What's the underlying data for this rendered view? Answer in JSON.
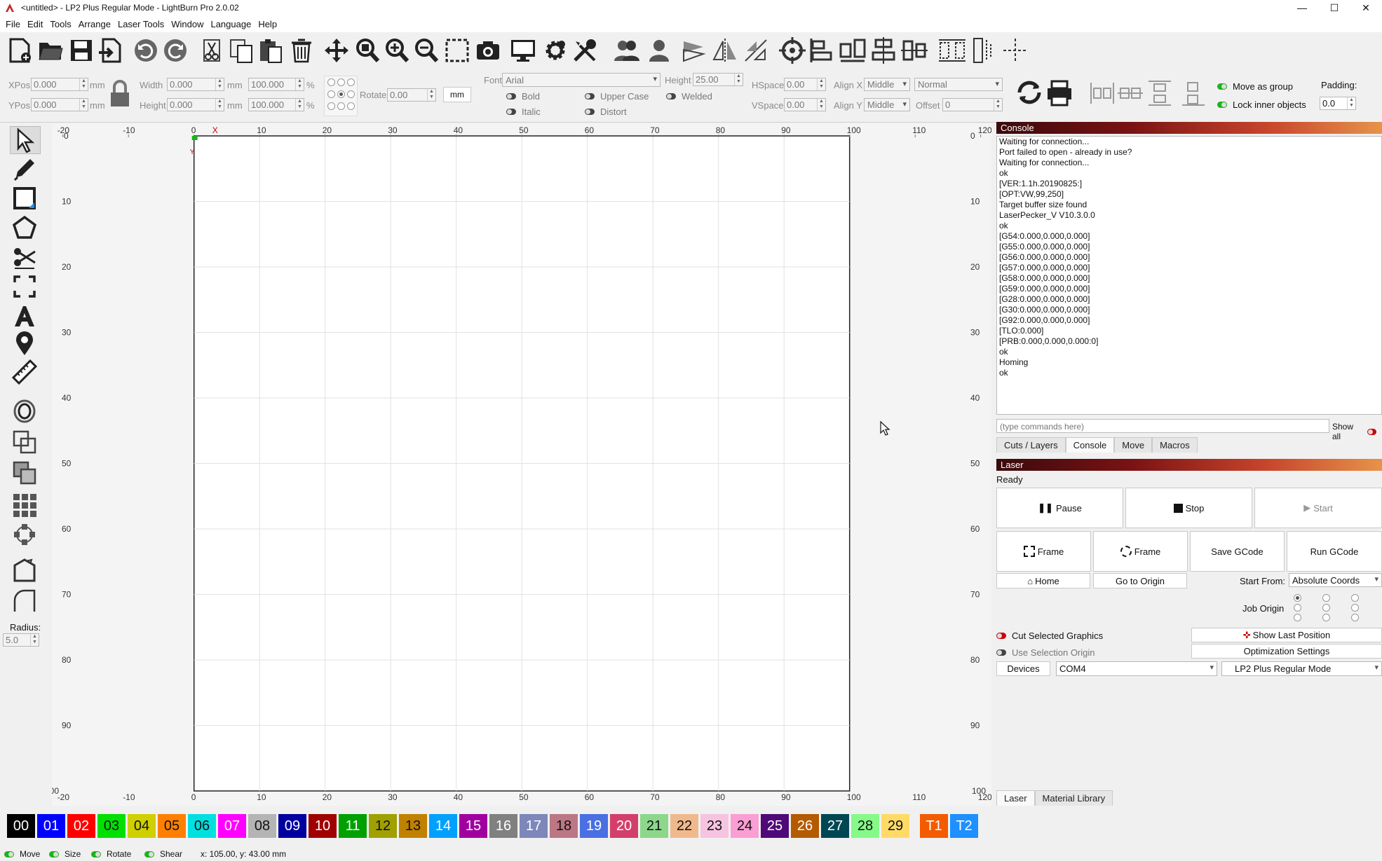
{
  "window": {
    "title": "<untitled> - LP2 Plus Regular Mode - LightBurn Pro 2.0.02"
  },
  "menu": [
    "File",
    "Edit",
    "Tools",
    "Arrange",
    "Laser Tools",
    "Window",
    "Language",
    "Help"
  ],
  "props": {
    "xpos_label": "XPos",
    "xpos": "0.000",
    "ypos_label": "YPos",
    "ypos": "0.000",
    "mm": "mm",
    "width_label": "Width",
    "width": "0.000",
    "height_label": "Height",
    "height": "0.000",
    "wpct": "100.000",
    "hpct": "100.000",
    "pct": "%",
    "rotate_label": "Rotate",
    "rotate": "0.00",
    "unit_btn": "mm",
    "font_label": "Font",
    "font": "Arial",
    "fheight_label": "Height",
    "fheight": "25.00",
    "bold": "Bold",
    "italic": "Italic",
    "upper": "Upper Case",
    "distort": "Distort",
    "welded": "Welded",
    "hspace_label": "HSpace",
    "hspace": "0.00",
    "vspace_label": "VSpace",
    "vspace": "0.00",
    "alignx_label": "Align X",
    "alignx": "Middle",
    "aligny_label": "Align Y",
    "aligny": "Middle",
    "normal": "Normal",
    "offset_label": "Offset",
    "offset": "0",
    "move_group": "Move as group",
    "lock_inner": "Lock inner objects",
    "padding_label": "Padding:",
    "padding": "0.0"
  },
  "left_tools": {
    "radius_label": "Radius:",
    "radius": "5.0"
  },
  "console": {
    "title": "Console",
    "lines": [
      "Waiting for connection...",
      "Port failed to open - already in use?",
      "Waiting for connection...",
      "ok",
      "[VER:1.1h.20190825:]",
      "[OPT:VW,99,250]",
      "Target buffer size found",
      "LaserPecker_V V10.3.0.0",
      "ok",
      "[G54:0.000,0.000,0.000]",
      "[G55:0.000,0.000,0.000]",
      "[G56:0.000,0.000,0.000]",
      "[G57:0.000,0.000,0.000]",
      "[G58:0.000,0.000,0.000]",
      "[G59:0.000,0.000,0.000]",
      "[G28:0.000,0.000,0.000]",
      "[G30:0.000,0.000,0.000]",
      "[G92:0.000,0.000,0.000]",
      "[TLO:0.000]",
      "[PRB:0.000,0.000,0.000:0]",
      "ok",
      "Homing",
      "ok"
    ],
    "placeholder": "(type commands here)",
    "show_all": "Show all"
  },
  "top_tabs": [
    "Cuts / Layers",
    "Console",
    "Move",
    "Macros"
  ],
  "laser": {
    "title": "Laser",
    "status": "Ready",
    "pause": "Pause",
    "stop": "Stop",
    "start": "Start",
    "frame1": "Frame",
    "frame2": "Frame",
    "save_gcode": "Save GCode",
    "run_gcode": "Run GCode",
    "home": "Home",
    "go_origin": "Go to Origin",
    "start_from_label": "Start From:",
    "start_from": "Absolute Coords",
    "job_origin_label": "Job Origin",
    "cut_selected": "Cut Selected Graphics",
    "use_selection": "Use Selection Origin",
    "show_last": "Show Last Position",
    "opt_settings": "Optimization Settings",
    "devices": "Devices",
    "port": "COM4",
    "device": "LP2 Plus Regular Mode"
  },
  "bottom_tabs": [
    "Laser",
    "Material Library"
  ],
  "palette": [
    {
      "l": "00",
      "c": "#000000",
      "w": true
    },
    {
      "l": "01",
      "c": "#0000ff",
      "w": true
    },
    {
      "l": "02",
      "c": "#ff0000",
      "w": true
    },
    {
      "l": "03",
      "c": "#00e000",
      "w": false
    },
    {
      "l": "04",
      "c": "#d0d000",
      "w": false
    },
    {
      "l": "05",
      "c": "#ff8000",
      "w": false
    },
    {
      "l": "06",
      "c": "#00e0e0",
      "w": false
    },
    {
      "l": "07",
      "c": "#ff00ff",
      "w": true
    },
    {
      "l": "08",
      "c": "#b4b4b4",
      "w": false
    },
    {
      "l": "09",
      "c": "#0000a0",
      "w": true
    },
    {
      "l": "10",
      "c": "#a00000",
      "w": true
    },
    {
      "l": "11",
      "c": "#00a000",
      "w": true
    },
    {
      "l": "12",
      "c": "#a0a000",
      "w": false
    },
    {
      "l": "13",
      "c": "#c08000",
      "w": false
    },
    {
      "l": "14",
      "c": "#00a0ff",
      "w": true
    },
    {
      "l": "15",
      "c": "#a000a0",
      "w": true
    },
    {
      "l": "16",
      "c": "#808080",
      "w": true
    },
    {
      "l": "17",
      "c": "#7d87b9",
      "w": true
    },
    {
      "l": "18",
      "c": "#bb7784",
      "w": false
    },
    {
      "l": "19",
      "c": "#4a6fe3",
      "w": true
    },
    {
      "l": "20",
      "c": "#d33f6a",
      "w": true
    },
    {
      "l": "21",
      "c": "#8cd78c",
      "w": false
    },
    {
      "l": "22",
      "c": "#f0b98d",
      "w": false
    },
    {
      "l": "23",
      "c": "#f6c4e1",
      "w": false
    },
    {
      "l": "24",
      "c": "#fa9ed4",
      "w": false
    },
    {
      "l": "25",
      "c": "#500a78",
      "w": true
    },
    {
      "l": "26",
      "c": "#b45a00",
      "w": true
    },
    {
      "l": "27",
      "c": "#004754",
      "w": true
    },
    {
      "l": "28",
      "c": "#86fa88",
      "w": false
    },
    {
      "l": "29",
      "c": "#ffdb66",
      "w": false
    },
    {
      "l": "T1",
      "c": "#f35b00",
      "w": true
    },
    {
      "l": "T2",
      "c": "#1e90ff",
      "w": true
    }
  ],
  "status": {
    "move": "Move",
    "size": "Size",
    "rotate": "Rotate",
    "shear": "Shear",
    "coords": "x: 105.00, y: 43.00 mm"
  },
  "canvas": {
    "xticks": [
      "-20",
      "-10",
      "0",
      "10",
      "20",
      "30",
      "40",
      "50",
      "60",
      "70",
      "80",
      "90",
      "100",
      "110",
      "120"
    ],
    "yticks": [
      "0",
      "10",
      "20",
      "30",
      "40",
      "50",
      "60",
      "70",
      "80",
      "90",
      "100"
    ],
    "axis_x": "X",
    "axis_y": "Y"
  },
  "colors": {
    "accent_panel": "#3a0d10",
    "canvas_bg": "#ffffff",
    "workspace": "#f7f7f7"
  }
}
